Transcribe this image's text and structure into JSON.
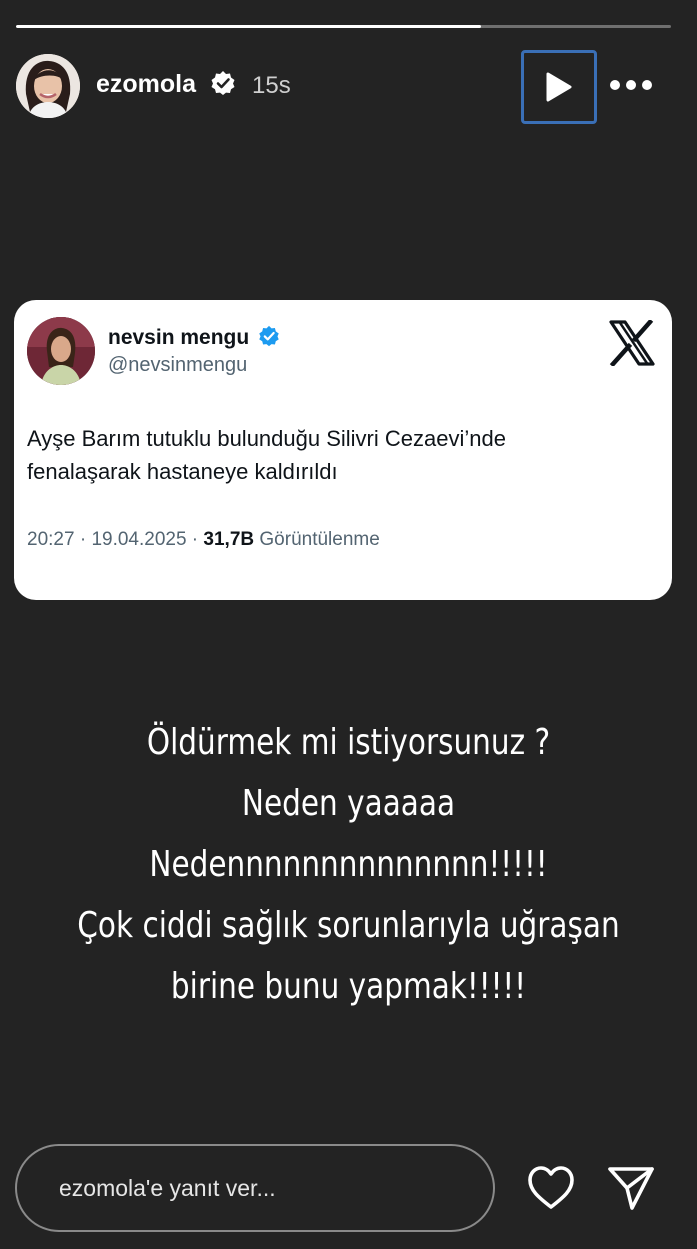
{
  "story": {
    "progress": 0.71,
    "username": "ezomola",
    "time": "15s",
    "icons": {
      "avatar": "profile-photo",
      "verified": "verified-badge-icon",
      "play": "play-icon",
      "more": "more-options-icon"
    }
  },
  "tweet": {
    "name": "nevsin mengu",
    "handle": "@nevsinmengu",
    "text_line1": "Ayşe Barım tutuklu bulunduğu Silivri Cezaevi’nde",
    "text_line2": "fenalaşarak hastaneye kaldırıldı",
    "time": "20:27",
    "sep1": " · ",
    "date": "19.04.2025",
    "sep2": " · ",
    "views_count": "31,7B",
    "views_label": " Görüntülenme",
    "icons": {
      "logo": "x-logo-icon",
      "verified": "blue-verified-icon"
    }
  },
  "caption": {
    "line1": "Öldürmek mi istiyorsunuz ?",
    "line2": "Neden yaaaaa",
    "line3": "Nedennnnnnnnnnnnnn!!!!!",
    "line4": "Çok ciddi sağlık sorunlarıyla uğraşan",
    "line5": "birine bunu yapmak!!!!!"
  },
  "footer": {
    "reply_placeholder": "ezomola'e yanıt ver...",
    "icons": {
      "like": "heart-icon",
      "send": "send-icon"
    }
  },
  "colors": {
    "background": "#232323",
    "tweet_background": "#ffffff",
    "verified_blue": "#1d9bf0",
    "play_highlight": "#3a6fb6"
  }
}
